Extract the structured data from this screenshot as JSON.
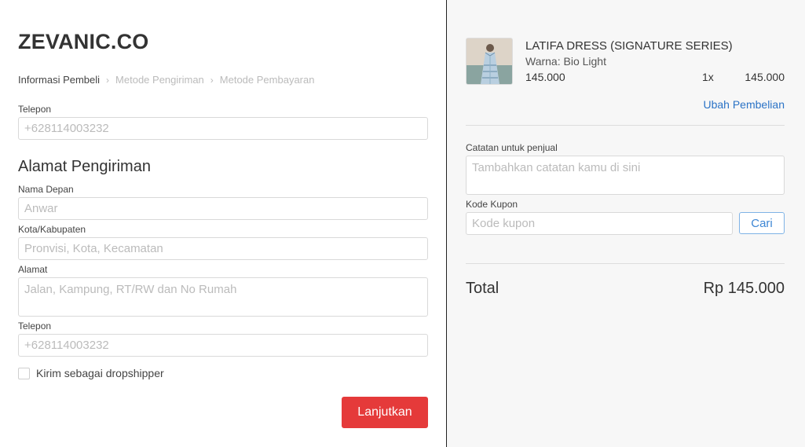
{
  "brand": "ZEVANIC.CO",
  "breadcrumb": {
    "step1": "Informasi Pembeli",
    "step2": "Metode Pengiriman",
    "step3": "Metode Pembayaran"
  },
  "contact": {
    "phone_label": "Telepon",
    "phone_placeholder": "+628114003232"
  },
  "shipping": {
    "title": "Alamat Pengiriman",
    "first_name_label": "Nama Depan",
    "first_name_placeholder": "Anwar",
    "city_label": "Kota/Kabupaten",
    "city_placeholder": "Pronvisi, Kota, Kecamatan",
    "address_label": "Alamat",
    "address_placeholder": "Jalan, Kampung, RT/RW dan No Rumah",
    "phone_label": "Telepon",
    "phone_placeholder": "+628114003232",
    "dropshipper_label": "Kirim sebagai dropshipper",
    "dropshipper_checked": false
  },
  "continue_button": "Lanjutkan",
  "order": {
    "product_name": "LATIFA DRESS (SIGNATURE SERIES)",
    "variant": "Warna: Bio Light",
    "price": "145.000",
    "quantity": "1x",
    "subtotal": "145.000",
    "change_link": "Ubah Pembelian"
  },
  "notes": {
    "label": "Catatan untuk penjual",
    "placeholder": "Tambahkan catatan kamu di sini"
  },
  "coupon": {
    "label": "Kode Kupon",
    "placeholder": "Kode kupon",
    "button": "Cari"
  },
  "total": {
    "label": "Total",
    "value": "Rp 145.000"
  },
  "colors": {
    "accent_red": "#e53a3a",
    "link_blue": "#2b73c6"
  }
}
